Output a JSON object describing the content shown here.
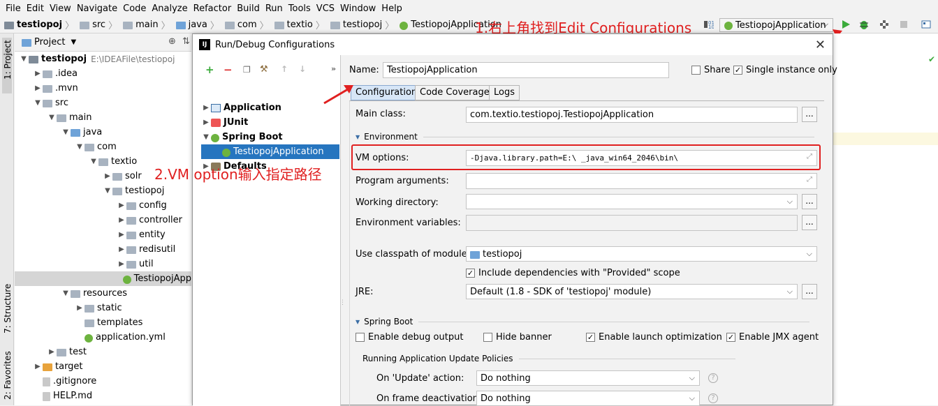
{
  "menubar": [
    "File",
    "Edit",
    "View",
    "Navigate",
    "Code",
    "Analyze",
    "Refactor",
    "Build",
    "Run",
    "Tools",
    "VCS",
    "Window",
    "Help"
  ],
  "breadcrumb": [
    "testiopoj",
    "src",
    "main",
    "java",
    "com",
    "textio",
    "testiopoj",
    "TestiopojApplication"
  ],
  "run_config_selector": "TestiopojApplication",
  "annotations": {
    "step1": "1.右上角找到Edit Configurations",
    "step2": "2.VM option输入指定路径"
  },
  "left_strip": {
    "project_tab": "1: Project",
    "structure_tab": "7: Structure",
    "favorites_tab": "2: Favorites"
  },
  "project_panel": {
    "title": "Project",
    "tree": [
      {
        "label": "testiopoj",
        "extra": "E:\\IDEAFile\\testiopoj",
        "indent": 0,
        "arrow": "▼",
        "icon": "proj",
        "bold": true
      },
      {
        "label": ".idea",
        "indent": 1,
        "arrow": "▶",
        "icon": "gray"
      },
      {
        "label": ".mvn",
        "indent": 1,
        "arrow": "▶",
        "icon": "gray"
      },
      {
        "label": "src",
        "indent": 1,
        "arrow": "▼",
        "icon": "gray"
      },
      {
        "label": "main",
        "indent": 2,
        "arrow": "▼",
        "icon": "gray"
      },
      {
        "label": "java",
        "indent": 3,
        "arrow": "▼",
        "icon": "blue"
      },
      {
        "label": "com",
        "indent": 4,
        "arrow": "▼",
        "icon": "gray"
      },
      {
        "label": "textio",
        "indent": 5,
        "arrow": "▼",
        "icon": "gray"
      },
      {
        "label": "solr",
        "indent": 6,
        "arrow": "▶",
        "icon": "gray"
      },
      {
        "label": "testiopoj",
        "indent": 6,
        "arrow": "▼",
        "icon": "gray"
      },
      {
        "label": "config",
        "indent": 7,
        "arrow": "▶",
        "icon": "gray"
      },
      {
        "label": "controller",
        "indent": 7,
        "arrow": "▶",
        "icon": "gray"
      },
      {
        "label": "entity",
        "indent": 7,
        "arrow": "▶",
        "icon": "gray"
      },
      {
        "label": "redisutil",
        "indent": 7,
        "arrow": "▶",
        "icon": "gray"
      },
      {
        "label": "util",
        "indent": 7,
        "arrow": "▶",
        "icon": "gray"
      },
      {
        "label": "TestiopojApp",
        "indent": 7,
        "arrow": "",
        "icon": "spring",
        "selected": true
      },
      {
        "label": "resources",
        "indent": 3,
        "arrow": "▼",
        "icon": "gray"
      },
      {
        "label": "static",
        "indent": 4,
        "arrow": "▶",
        "icon": "gray"
      },
      {
        "label": "templates",
        "indent": 4,
        "arrow": "",
        "icon": "gray"
      },
      {
        "label": "application.yml",
        "indent": 4,
        "arrow": "",
        "icon": "spring"
      },
      {
        "label": "test",
        "indent": 2,
        "arrow": "▶",
        "icon": "gray"
      },
      {
        "label": "target",
        "indent": 1,
        "arrow": "▶",
        "icon": "yel"
      },
      {
        "label": ".gitignore",
        "indent": 1,
        "arrow": "",
        "icon": "file"
      },
      {
        "label": "HELP.md",
        "indent": 1,
        "arrow": "",
        "icon": "md"
      }
    ]
  },
  "dialog": {
    "title": "Run/Debug Configurations",
    "tree": [
      {
        "label": "Application",
        "arrow": "▶",
        "icon": "app"
      },
      {
        "label": "JUnit",
        "arrow": "▶",
        "icon": "junit"
      },
      {
        "label": "Spring Boot",
        "arrow": "▼",
        "icon": "spring"
      },
      {
        "label": "TestiopojApplication",
        "arrow": "",
        "icon": "spring",
        "selected": true
      },
      {
        "label": "Defaults",
        "arrow": "▶",
        "icon": "def"
      }
    ],
    "name_label": "Name:",
    "name_value": "TestiopojApplication",
    "share_label": "Share",
    "single_instance_label": "Single instance only",
    "tabs": [
      "Configuration",
      "Code Coverage",
      "Logs"
    ],
    "main_class_label": "Main class:",
    "main_class_value": "com.textio.testiopoj.TestiopojApplication",
    "environment_section": "Environment",
    "vm_options_label": "VM options:",
    "vm_options_value": "-Djava.library.path=E:\\          _java_win64_2046\\bin\\",
    "program_args_label": "Program arguments:",
    "working_dir_label": "Working directory:",
    "env_vars_label": "Environment variables:",
    "classpath_label": "Use classpath of module:",
    "classpath_value": "testiopoj",
    "include_deps_label": "Include dependencies with \"Provided\" scope",
    "jre_label": "JRE:",
    "jre_value": "Default (1.8 - SDK of 'testiopoj' module)",
    "spring_boot_section": "Spring Boot",
    "debug_output_label": "Enable debug output",
    "hide_banner_label": "Hide banner",
    "launch_opt_label": "Enable launch optimization",
    "jmx_label": "Enable JMX agent",
    "update_policies_label": "Running Application Update Policies",
    "on_update_label": "On 'Update' action:",
    "on_update_value": "Do nothing",
    "on_frame_label": "On frame deactivation:",
    "on_frame_value": "Do nothing",
    "browse_label": "...",
    "help_label": "?"
  },
  "colors": {
    "annotation": "#e02020",
    "selection": "#2675bf",
    "spring": "#6db33f",
    "run": "#3bab3b"
  }
}
